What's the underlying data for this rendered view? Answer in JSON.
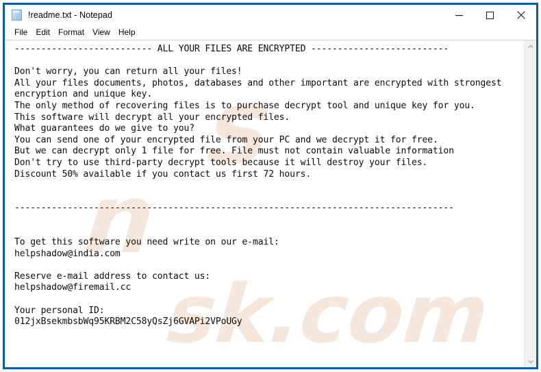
{
  "window": {
    "title": "!readme.txt - Notepad",
    "icon": "notepad-document-icon",
    "border_color": "#0c5ba4",
    "controls": {
      "minimize_label": "Minimize",
      "maximize_label": "Maximize",
      "close_label": "Close"
    }
  },
  "menubar": {
    "items": [
      {
        "label": "File"
      },
      {
        "label": "Edit"
      },
      {
        "label": "Format"
      },
      {
        "label": "View"
      },
      {
        "label": "Help"
      }
    ]
  },
  "editor": {
    "font": "monospace",
    "text_color": "#0c0c0c",
    "content": "-------------------------- ALL YOUR FILES ARE ENCRYPTED --------------------------\n\nDon't worry, you can return all your files!\nAll your files documents, photos, databases and other important are encrypted with strongest\nencryption and unique key.\nThe only method of recovering files is to purchase decrypt tool and unique key for you.\nThis software will decrypt all your encrypted files.\nWhat guarantees do we give to you?\nYou can send one of your encrypted file from your PC and we decrypt it for free.\nBut we can decrypt only 1 file for free. File must not contain valuable information\nDon't try to use third-party decrypt tools because it will destroy your files.\nDiscount 50% available if you contact us first 72 hours.\n\n\n-----------------------------------------------------------------------------------\n\n\nTo get this software you need write on our e-mail:\nhelpshadow@india.com\n\nReserve e-mail address to contact us:\nhelpshadow@firemail.cc\n\nYour personal ID:\n012jxBsekmbsbWq95KRBM2C58yQsZj6GVAPi2VPoUGy",
    "lines": [
      "-------------------------- ALL YOUR FILES ARE ENCRYPTED --------------------------",
      "",
      "Don't worry, you can return all your files!",
      "All your files documents, photos, databases and other important are encrypted with strongest",
      "encryption and unique key.",
      "The only method of recovering files is to purchase decrypt tool and unique key for you.",
      "This software will decrypt all your encrypted files.",
      "What guarantees do we give to you?",
      "You can send one of your encrypted file from your PC and we decrypt it for free.",
      "But we can decrypt only 1 file for free. File must not contain valuable information",
      "Don't try to use third-party decrypt tools because it will destroy your files.",
      "Discount 50% available if you contact us first 72 hours.",
      "",
      "",
      "-----------------------------------------------------------------------------------",
      "",
      "",
      "To get this software you need write on our e-mail:",
      "helpshadow@india.com",
      "",
      "Reserve e-mail address to contact us:",
      "helpshadow@firemail.cc",
      "",
      "Your personal ID:",
      "012jxBsekmbsbWq95KRBM2C58yQsZj6GVAPi2VPoUGy"
    ],
    "ransom_note": {
      "headline": "ALL YOUR FILES ARE ENCRYPTED",
      "primary_email": "helpshadow@india.com",
      "reserve_email": "helpshadow@firemail.cc",
      "personal_id": "012jxBsekmbsbWq95KRBM2C58yQsZj6GVAPi2VPoUGy",
      "discount_percent": "50%",
      "discount_window_hours": "72",
      "free_decrypt_file_count": "1"
    }
  },
  "scrollbar": {
    "up_arrow": "chevron-up-icon",
    "down_arrow": "chevron-down-icon",
    "thumb_visible": false
  },
  "watermark": {
    "line1": "s",
    "line2": "sk.com",
    "line3": "n"
  }
}
